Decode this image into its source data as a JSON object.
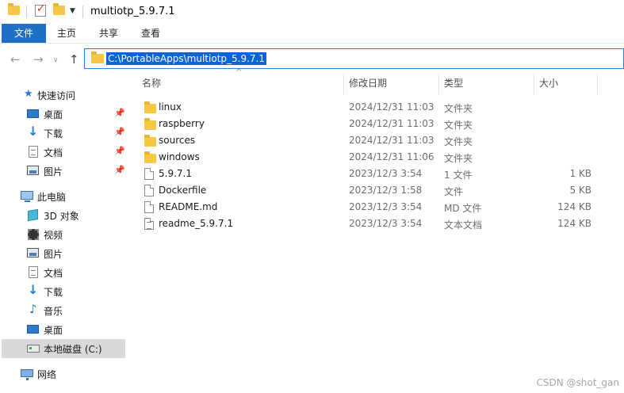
{
  "window": {
    "title": "multiotp_5.9.7.1"
  },
  "ribbon": {
    "tabs": [
      {
        "label": "文件"
      },
      {
        "label": "主页"
      },
      {
        "label": "共享"
      },
      {
        "label": "查看"
      }
    ]
  },
  "address": {
    "path": "C:\\PortableApps\\multiotp_5.9.7.1"
  },
  "sidebar": {
    "quick_access": "快速访问",
    "quick_items": [
      {
        "label": "桌面",
        "icon": "desktop-icon"
      },
      {
        "label": "下载",
        "icon": "download-icon"
      },
      {
        "label": "文档",
        "icon": "document-icon"
      },
      {
        "label": "图片",
        "icon": "picture-icon"
      }
    ],
    "this_pc": "此电脑",
    "pc_items": [
      {
        "label": "3D 对象",
        "icon": "3d-objects-icon"
      },
      {
        "label": "视频",
        "icon": "video-icon"
      },
      {
        "label": "图片",
        "icon": "picture-icon"
      },
      {
        "label": "文档",
        "icon": "document-icon"
      },
      {
        "label": "下载",
        "icon": "download-icon"
      },
      {
        "label": "音乐",
        "icon": "music-icon"
      },
      {
        "label": "桌面",
        "icon": "desktop-icon"
      },
      {
        "label": "本地磁盘 (C:)",
        "icon": "drive-icon"
      }
    ],
    "network": "网络"
  },
  "columns": {
    "name": "名称",
    "date": "修改日期",
    "type": "类型",
    "size": "大小"
  },
  "files": [
    {
      "name": "linux",
      "date": "2024/12/31 11:03",
      "type": "文件夹",
      "size": "",
      "kind": "folder"
    },
    {
      "name": "raspberry",
      "date": "2024/12/31 11:03",
      "type": "文件夹",
      "size": "",
      "kind": "folder"
    },
    {
      "name": "sources",
      "date": "2024/12/31 11:03",
      "type": "文件夹",
      "size": "",
      "kind": "folder"
    },
    {
      "name": "windows",
      "date": "2024/12/31 11:06",
      "type": "文件夹",
      "size": "",
      "kind": "folder"
    },
    {
      "name": "5.9.7.1",
      "date": "2023/12/3 3:54",
      "type": "1 文件",
      "size": "1 KB",
      "kind": "file"
    },
    {
      "name": "Dockerfile",
      "date": "2023/12/3 1:58",
      "type": "文件",
      "size": "5 KB",
      "kind": "file"
    },
    {
      "name": "README.md",
      "date": "2023/12/3 3:54",
      "type": "MD 文件",
      "size": "124 KB",
      "kind": "file"
    },
    {
      "name": "readme_5.9.7.1",
      "date": "2023/12/3 3:54",
      "type": "文本文档",
      "size": "124 KB",
      "kind": "textfile"
    }
  ],
  "watermark": "CSDN @shot_gan"
}
